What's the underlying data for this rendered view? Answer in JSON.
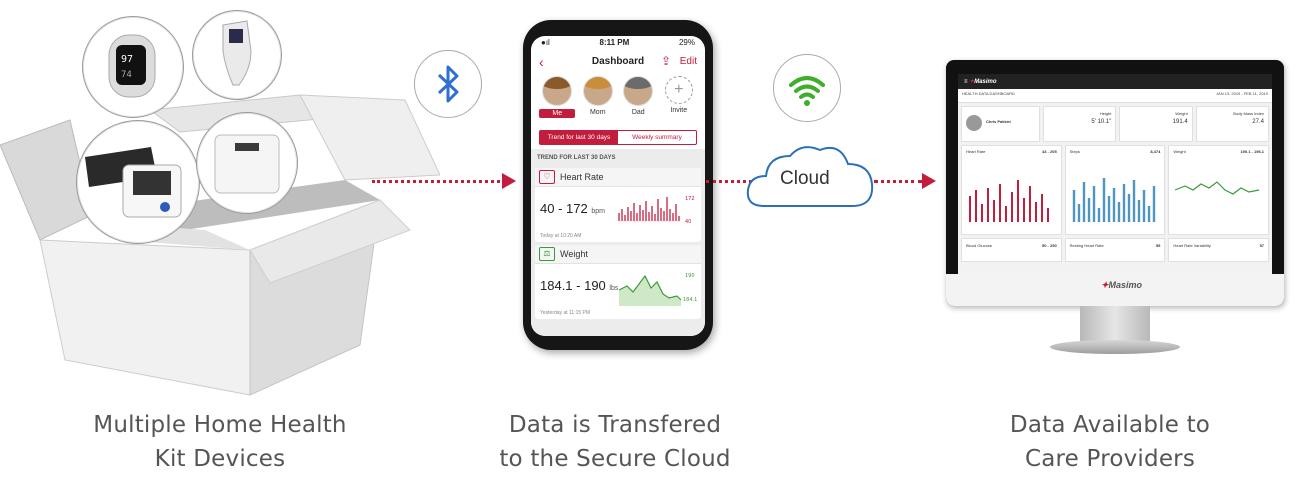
{
  "captions": {
    "devices": [
      "Multiple Home Health",
      "Kit  Devices"
    ],
    "phone": [
      "Data is Transfered",
      "to the Secure Cloud"
    ],
    "providers": [
      "Data Available to",
      "Care Providers"
    ]
  },
  "icons": {
    "bluetooth": "bluetooth-icon",
    "wifi": "wifi-icon",
    "cloud": "cloud-icon"
  },
  "cloud_label": "Cloud",
  "colors": {
    "accent": "#c21d3c",
    "bluetooth": "#2f6fd1",
    "wifi": "#3fae2a",
    "cloud_outline": "#2a6fb8"
  },
  "phone_app": {
    "status_time": "8:11 PM",
    "status_battery": "29%",
    "title": "Dashboard",
    "edit_label": "Edit",
    "people": [
      "Me",
      "Mom",
      "Dad",
      "Invite"
    ],
    "tabs": [
      "Trend for last 30 days",
      "Weekly summary"
    ],
    "trend_label": "TREND FOR LAST 30 DAYS",
    "cards": [
      {
        "title": "Heart Rate",
        "value": "40 - 172",
        "unit": "bpm",
        "footer": "Today at 10:20 AM",
        "max_label": "172",
        "min_label": "40"
      },
      {
        "title": "Weight",
        "value": "184.1 - 190",
        "unit": "lbs",
        "footer": "Yesterday at 11:15 PM",
        "max_label": "190",
        "min_label": "184.1"
      }
    ]
  },
  "monitor_app": {
    "brand": "Masimo",
    "title": "HEALTH DATA DASHBOARD",
    "patient": "Chris Patient",
    "height_label": "Height",
    "height": "5' 10.1\"",
    "weight_label": "Weight",
    "weight": "191.4",
    "bmi_label": "Body Mass Index",
    "bmi": "27.4",
    "heart_rate_label": "Heart Rate",
    "heart_rate": "43 - 205",
    "steps_label": "Steps",
    "steps": "8,474",
    "weight_range": "190.1 - 196.1",
    "blood_glucose_label": "Blood Glucose",
    "blood_glucose": "50 - 250",
    "resting_hr_label": "Resting Heart Rate",
    "resting_hr": "55",
    "hrv_label": "Heart Rate Variability",
    "hrv": "57",
    "date_range": "JAN 13, 2019 - FEB 11, 2019"
  }
}
